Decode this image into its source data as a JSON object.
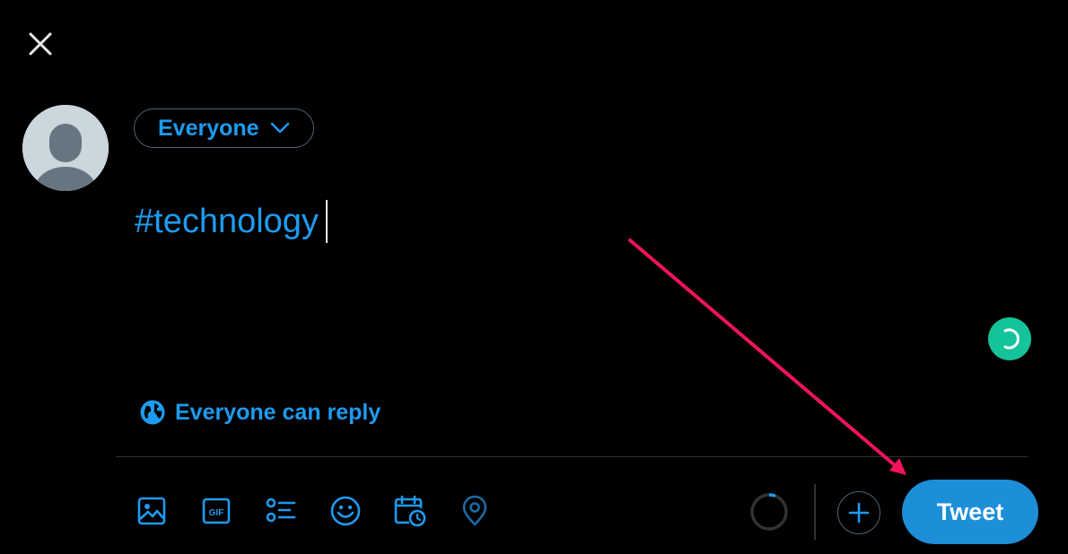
{
  "dialog": {
    "close_icon": "close-icon"
  },
  "composer": {
    "avatar_icon": "default-avatar-icon",
    "audience_label": "Everyone",
    "audience_icon": "chevron-down-icon",
    "text": "#technology",
    "grammarly_icon": "grammarly-icon",
    "reply_setting_label": "Everyone can reply",
    "reply_setting_icon": "globe-icon"
  },
  "toolbar": {
    "icons": [
      "image-icon",
      "gif-icon",
      "poll-icon",
      "emoji-icon",
      "schedule-icon",
      "location-icon"
    ],
    "progress_icon": "character-count-ring",
    "add_icon": "plus-icon",
    "tweet_label": "Tweet"
  },
  "colors": {
    "accent": "#1d9bf0",
    "tweet_button": "#1d8ed8",
    "background": "#000000",
    "border": "#536471",
    "grammarly": "#15c39a",
    "annotation_arrow": "#f0145a"
  }
}
